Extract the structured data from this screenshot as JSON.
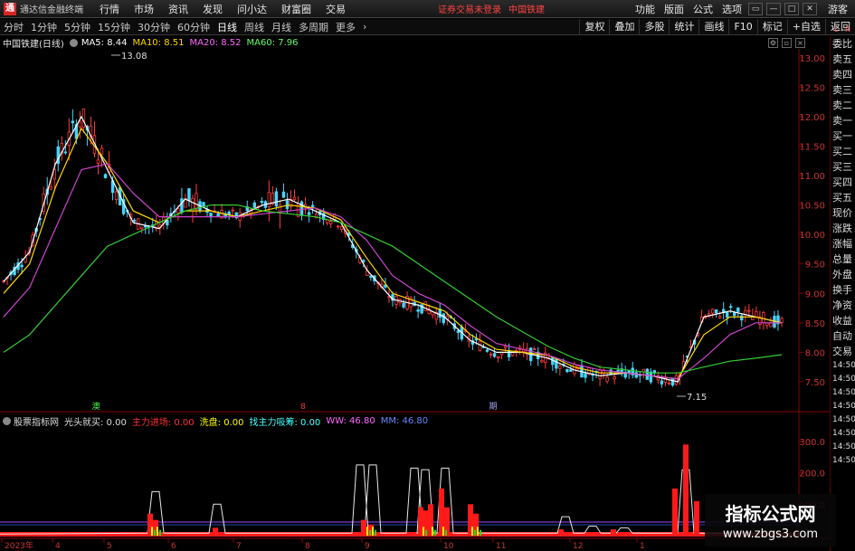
{
  "titlebar": {
    "app_name": "通达信金融终端",
    "menu": [
      "行情",
      "市场",
      "资讯",
      "发现",
      "问小达",
      "财富圈",
      "交易"
    ],
    "login_status": "证券交易未登录",
    "stock": "中国铁建",
    "right_items": [
      "功能",
      "版面",
      "公式",
      "选项"
    ],
    "guest": "游客"
  },
  "toolbar": {
    "periods": [
      "分时",
      "1分钟",
      "5分钟",
      "15分钟",
      "30分钟",
      "60分钟",
      "日线",
      "周线",
      "月线",
      "多周期",
      "更多"
    ],
    "active_period": "日线",
    "tools": [
      "复权",
      "叠加",
      "多股",
      "统计",
      "画线",
      "F10",
      "标记",
      "+自选",
      "返回"
    ]
  },
  "main_chart": {
    "stock_label": "中国铁建(日线)",
    "ma": [
      {
        "label": "MA5: 8.44",
        "color": "#ffffff"
      },
      {
        "label": "MA10: 8.51",
        "color": "#ffd700"
      },
      {
        "label": "MA20: 8.52",
        "color": "#ff66ff"
      },
      {
        "label": "MA60: 7.96",
        "color": "#66ff66"
      }
    ],
    "high_label": "13.08",
    "low_label": "7.15",
    "price_ticks": [
      "13.00",
      "12.50",
      "12.00",
      "11.50",
      "11.00",
      "10.50",
      "10.00",
      "9.50",
      "9.00",
      "8.50",
      "8.00",
      "7.50"
    ],
    "price_range": [
      7.1,
      13.15
    ],
    "event_markers": [
      "澳",
      "8",
      "期"
    ]
  },
  "chart_data": {
    "type": "line",
    "title": "中国铁建(日线)",
    "ylim": [
      7.1,
      13.15
    ],
    "series": [
      {
        "name": "MA5",
        "values": [
          9.2,
          9.7,
          11.2,
          12.0,
          11.1,
          10.2,
          10.1,
          10.6,
          10.4,
          10.3,
          10.5,
          10.6,
          10.4,
          10.2,
          9.4,
          8.9,
          8.8,
          8.6,
          8.2,
          8.0,
          8.0,
          7.9,
          7.7,
          7.6,
          7.65,
          7.6,
          7.5,
          8.6,
          8.7,
          8.6,
          8.5
        ]
      },
      {
        "name": "MA10",
        "values": [
          9.0,
          9.5,
          10.8,
          11.8,
          11.2,
          10.4,
          10.2,
          10.4,
          10.4,
          10.3,
          10.4,
          10.5,
          10.45,
          10.25,
          9.6,
          9.0,
          8.85,
          8.7,
          8.3,
          8.05,
          8.0,
          7.95,
          7.75,
          7.65,
          7.65,
          7.6,
          7.55,
          8.3,
          8.6,
          8.6,
          8.5
        ]
      },
      {
        "name": "MA20",
        "values": [
          8.6,
          9.1,
          10.1,
          11.1,
          11.2,
          10.7,
          10.3,
          10.3,
          10.3,
          10.3,
          10.35,
          10.4,
          10.45,
          10.3,
          9.9,
          9.3,
          9.0,
          8.8,
          8.45,
          8.15,
          8.05,
          7.95,
          7.8,
          7.7,
          7.65,
          7.6,
          7.55,
          7.9,
          8.3,
          8.5,
          8.5
        ]
      },
      {
        "name": "MA60",
        "values": [
          8.0,
          8.3,
          8.8,
          9.3,
          9.8,
          10.0,
          10.2,
          10.4,
          10.5,
          10.5,
          10.4,
          10.35,
          10.3,
          10.2,
          10.0,
          9.8,
          9.5,
          9.2,
          8.9,
          8.6,
          8.35,
          8.1,
          7.9,
          7.75,
          7.7,
          7.65,
          7.65,
          7.75,
          7.85,
          7.9,
          7.96
        ]
      }
    ]
  },
  "indicator": {
    "name": "股票指标网",
    "items": [
      {
        "label": "光头就买: 0.00",
        "color": "#dddddd"
      },
      {
        "label": "主力进场: 0.00",
        "color": "#ff3333"
      },
      {
        "label": "洗盘: 0.00",
        "color": "#ffff00"
      },
      {
        "label": "找主力吸筹: 0.00",
        "color": "#44ffff"
      },
      {
        "label": "WW: 46.80",
        "color": "#ff66ff"
      },
      {
        "label": "MM: 46.80",
        "color": "#6688ff"
      }
    ],
    "ticks": [
      "300.0",
      "200.0",
      "100.0"
    ]
  },
  "date_axis": [
    "2023年",
    "4",
    "5",
    "6",
    "7",
    "8",
    "9",
    "10",
    "11",
    "12",
    "1"
  ],
  "right_panel": {
    "items": [
      "委比",
      "卖五",
      "卖四",
      "卖三",
      "卖二",
      "卖一",
      "买一",
      "买二",
      "买三",
      "买四",
      "买五",
      "现价",
      "涨跌",
      "涨幅",
      "总量",
      "外盘",
      "换手",
      "净资",
      "收益",
      "自动",
      "交易",
      "14:50",
      "14:50",
      "14:50",
      "14:50",
      "14:50",
      "14:50",
      "14:50",
      "14:50"
    ],
    "top_marks": [
      "L",
      "R"
    ]
  },
  "watermark": {
    "title": "指标公式网",
    "url": "www.zbgs3.com"
  },
  "colors": {
    "up": "#ff3b3b",
    "down": "#47d6ff",
    "axis": "#8b0000"
  }
}
